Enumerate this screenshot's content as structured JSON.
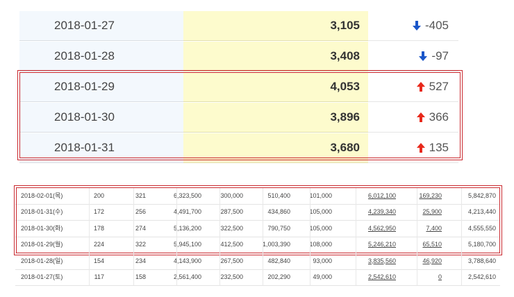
{
  "top_rows": [
    {
      "date": "2018-01-27",
      "value": "3,105",
      "direction": "down",
      "change": "-405"
    },
    {
      "date": "2018-01-28",
      "value": "3,408",
      "direction": "down",
      "change": "-97"
    },
    {
      "date": "2018-01-29",
      "value": "4,053",
      "direction": "up",
      "change": "527"
    },
    {
      "date": "2018-01-30",
      "value": "3,896",
      "direction": "up",
      "change": "366"
    },
    {
      "date": "2018-01-31",
      "value": "3,680",
      "direction": "up",
      "change": "135"
    }
  ],
  "bottom_rows": [
    [
      "2018-02-01(목)",
      "200",
      "321",
      "6,323,500",
      "300,000",
      "510,400",
      "101,000",
      "6,012,100",
      "169,230",
      "5,842,870"
    ],
    [
      "2018-01-31(수)",
      "172",
      "256",
      "4,491,700",
      "287,500",
      "434,860",
      "105,000",
      "4,239,340",
      "25,900",
      "4,213,440"
    ],
    [
      "2018-01-30(화)",
      "178",
      "274",
      "5,136,200",
      "322,500",
      "790,750",
      "105,000",
      "4,562,950",
      "7,400",
      "4,555,550"
    ],
    [
      "2018-01-29(월)",
      "224",
      "322",
      "5,945,100",
      "412,500",
      "1,003,390",
      "108,000",
      "5,246,210",
      "65,510",
      "5,180,700"
    ],
    [
      "2018-01-28(일)",
      "154",
      "234",
      "4,143,900",
      "267,500",
      "482,840",
      "93,000",
      "3,835,560",
      "46,920",
      "3,788,640"
    ],
    [
      "2018-01-27(토)",
      "117",
      "158",
      "2,561,400",
      "232,500",
      "202,290",
      "49,000",
      "2,542,610",
      "0",
      "2,542,610"
    ]
  ],
  "colors": {
    "up": "#e8291c",
    "down": "#1a56c9",
    "highlight": "#c9272d"
  }
}
